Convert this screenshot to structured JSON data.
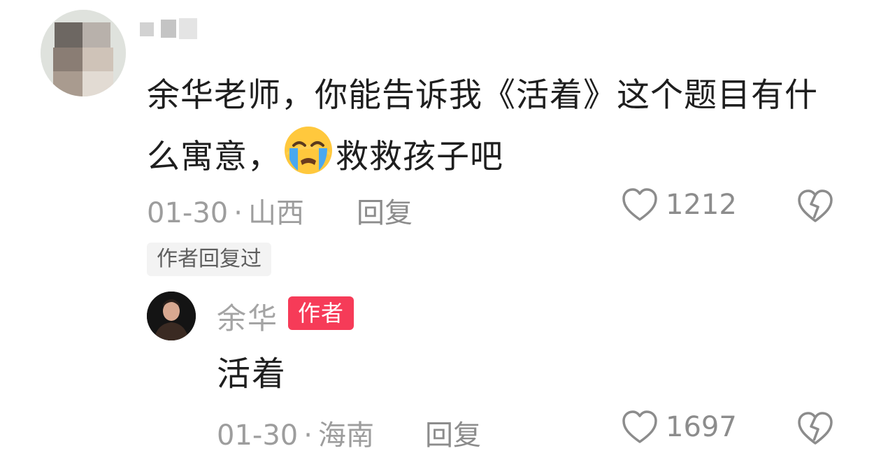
{
  "comment": {
    "text_before_emoji": "余华老师，你能告诉我《活着》这个题目有什么寓意，",
    "emoji_icon": "crying-face-emoji",
    "text_after_emoji": "救救孩子吧",
    "date": "01-30",
    "separator": "·",
    "location": "山西",
    "reply_label": "回复",
    "like_count": "1212",
    "author_replied_badge": "作者回复过"
  },
  "reply": {
    "username": "余华",
    "author_tag": "作者",
    "text": "活着",
    "date": "01-30",
    "separator": "·",
    "location": "海南",
    "reply_label": "回复",
    "like_count": "1697"
  },
  "colors": {
    "author_tag_bg": "#f63b58",
    "meta_gray": "#9d9d9d"
  }
}
